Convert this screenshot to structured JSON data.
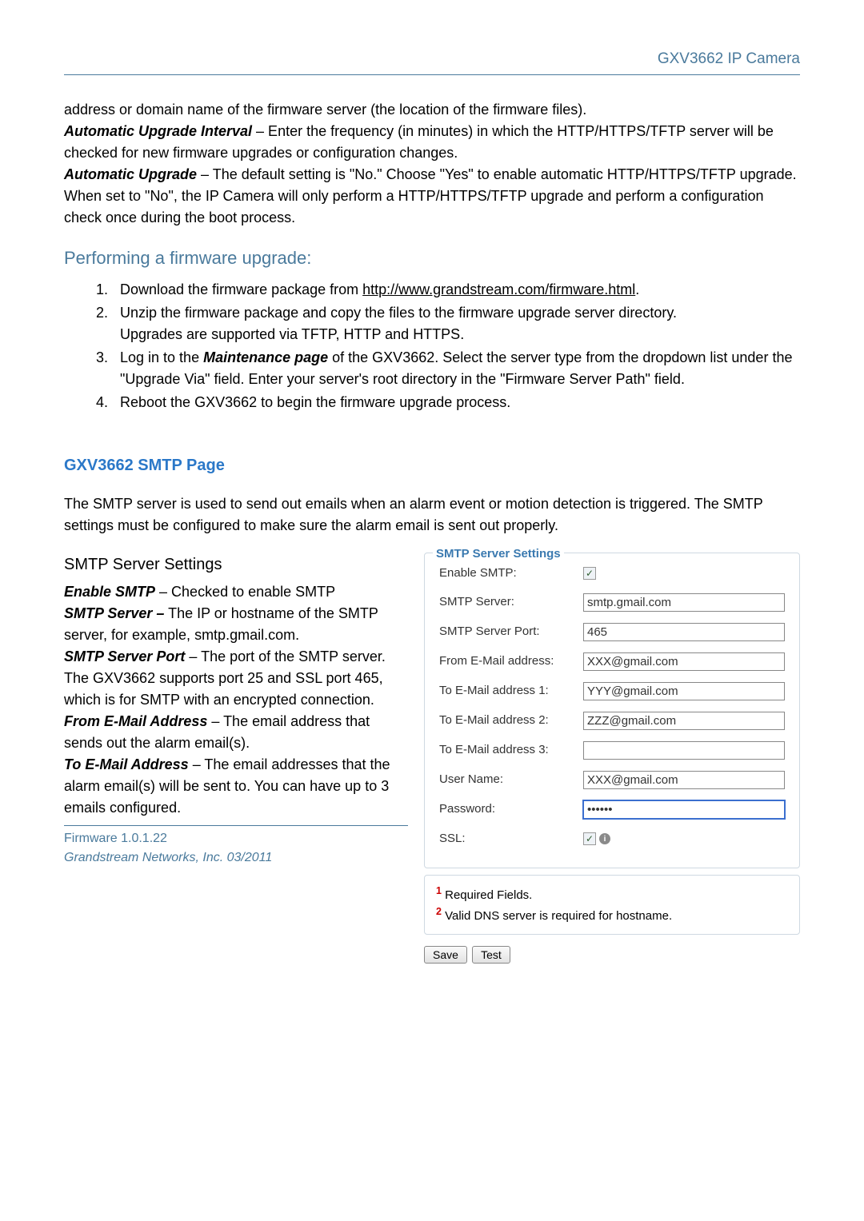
{
  "header": {
    "product": "GXV3662 IP Camera"
  },
  "intro": {
    "p1a": "address or domain name of the firmware server (the location of the firmware files).",
    "p1_label": "Automatic Upgrade Interval",
    "p1b": " – Enter the frequency (in minutes) in which the HTTP/HTTPS/TFTP server will be checked for new firmware upgrades or configuration changes.",
    "p2_label": "Automatic Upgrade",
    "p2": " – The default setting is \"No.\" Choose \"Yes\" to enable automatic HTTP/HTTPS/TFTP upgrade. When set to \"No\", the IP Camera will only perform a HTTP/HTTPS/TFTP upgrade and perform a configuration check once during the boot process."
  },
  "firmware": {
    "heading": "Performing a firmware upgrade:",
    "steps": [
      {
        "pre": "Download the firmware package from ",
        "link": "http://www.grandstream.com/firmware.html",
        "post": "."
      },
      {
        "text": "Unzip the firmware package and copy the files to the firmware upgrade server directory.",
        "extra": "Upgrades are supported via TFTP, HTTP and HTTPS."
      },
      {
        "pre": "Log in to the ",
        "bold": "Maintenance page",
        "post": " of the GXV3662. Select the server type from the dropdown list under the \"Upgrade Via\" field.    Enter your server's root directory in the \"Firmware Server Path\" field."
      },
      {
        "text": "Reboot the GXV3662 to begin the firmware upgrade process."
      }
    ]
  },
  "smtp": {
    "title": "GXV3662 SMTP Page",
    "intro": "The SMTP server is used to send out emails when an alarm event or motion detection is triggered.    The SMTP settings must be configured to make sure the alarm email is sent out properly.",
    "subheading": "SMTP Server Settings",
    "desc": {
      "enable_label": "Enable SMTP",
      "enable": " – Checked to enable SMTP",
      "server_label": "SMTP Server –",
      "server": " The IP or hostname of the SMTP server, for example, smtp.gmail.com.",
      "port_label": "SMTP Server Port",
      "port": " – The port of the SMTP server. The GXV3662 supports port 25 and SSL port 465, which is for SMTP with an encrypted connection.",
      "from_label": "From E-Mail Address",
      "from": " – The email address that sends out the alarm email(s).",
      "to_label": "To E-Mail Address",
      "to": " – The email addresses that the alarm email(s) will be sent to. You can have up to 3 emails configured."
    }
  },
  "form": {
    "legend": "SMTP Server Settings",
    "labels": {
      "enable": "Enable SMTP:",
      "server": "SMTP Server:",
      "port": "SMTP Server Port:",
      "from": "From E-Mail address:",
      "to1": "To E-Mail address 1:",
      "to2": "To E-Mail address 2:",
      "to3": "To E-Mail address 3:",
      "user": "User Name:",
      "pass": "Password:",
      "ssl": "SSL:"
    },
    "values": {
      "enable_checked": "✓",
      "server": "smtp.gmail.com",
      "port": "465",
      "from": "XXX@gmail.com",
      "to1": "YYY@gmail.com",
      "to2": "ZZZ@gmail.com",
      "to3": "",
      "user": "XXX@gmail.com",
      "pass": "••••••",
      "ssl_checked": "✓"
    },
    "notes": {
      "n1_sup": "1",
      "n1": " Required Fields.",
      "n2_sup": "2",
      "n2": " Valid DNS server is required for hostname."
    },
    "buttons": {
      "save": "Save",
      "test": "Test"
    }
  },
  "footer": {
    "line1": "Firmware 1.0.1.22",
    "line2a": "Grandstream Networks, Inc.    ",
    "line2b": "03/2011"
  }
}
